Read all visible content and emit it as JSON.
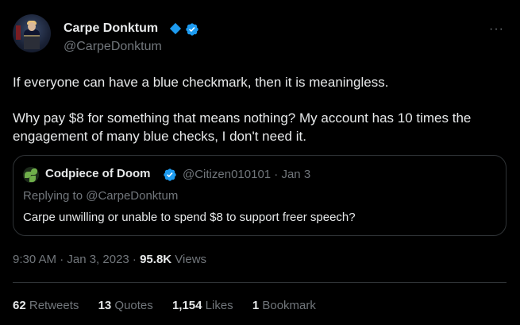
{
  "author": {
    "display_name": "Carpe Donktum",
    "handle": "@CarpeDonktum"
  },
  "tweet": {
    "line1": "If everyone can have a blue checkmark, then it is meaningless.",
    "line2": "Why pay $8 for something that means nothing? My account has 10 times the engagement of many blue checks, I don't need it."
  },
  "quoted": {
    "display_name": "Codpiece of Doom",
    "handle_date": "@Citizen010101 · Jan 3",
    "replying_to": "Replying to @CarpeDonktum",
    "text": "Carpe unwilling or unable to spend $8 to support freer speech?"
  },
  "meta": {
    "time_date": "9:30 AM · Jan 3, 2023 · ",
    "views_count": "95.8K",
    "views_label": " Views"
  },
  "stats": {
    "retweets_count": "62",
    "retweets_label": " Retweets",
    "quotes_count": "13",
    "quotes_label": " Quotes",
    "likes_count": "1,154",
    "likes_label": " Likes",
    "bookmarks_count": "1",
    "bookmarks_label": " Bookmark"
  },
  "icons": {
    "more": "more-icon",
    "verified": "verified-icon",
    "diamond": "diamond-icon"
  },
  "colors": {
    "background": "#000000",
    "text": "#e7e9ea",
    "muted": "#71767b",
    "accent": "#1d9bf0",
    "border": "#2f3336"
  }
}
